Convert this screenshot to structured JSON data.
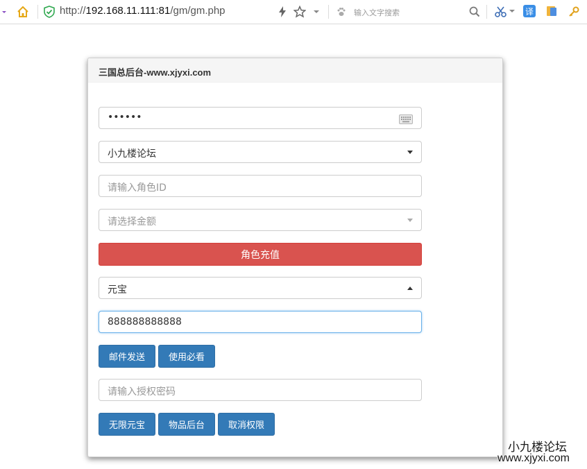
{
  "browser": {
    "url_prefix": "http://",
    "url_host": "192.168.11.111:81",
    "url_path": "/gm/gm.php",
    "search_placeholder": "输入文字搜索",
    "translate_label": "译"
  },
  "panel": {
    "title": "三国总后台-www.xjyxi.com",
    "password_value": "••••••",
    "server_select_value": "小九楼论坛",
    "role_id_placeholder": "请输入角色ID",
    "amount_select_placeholder": "请选择金额",
    "recharge_button": "角色充值",
    "item_select_value": "元宝",
    "quantity_value": "888888888888",
    "mail_send_button": "邮件发送",
    "usage_guide_button": "使用必看",
    "auth_password_placeholder": "请输入授权密码",
    "unlimited_yuanbao_button": "无限元宝",
    "item_backend_button": "物品后台",
    "cancel_permission_button": "取消权限"
  },
  "watermark": {
    "line1": "小九楼论坛",
    "line2": "www.xjyxi.com"
  },
  "colors": {
    "danger": "#d9534f",
    "primary": "#337ab7",
    "focus_border": "#66afe9"
  }
}
